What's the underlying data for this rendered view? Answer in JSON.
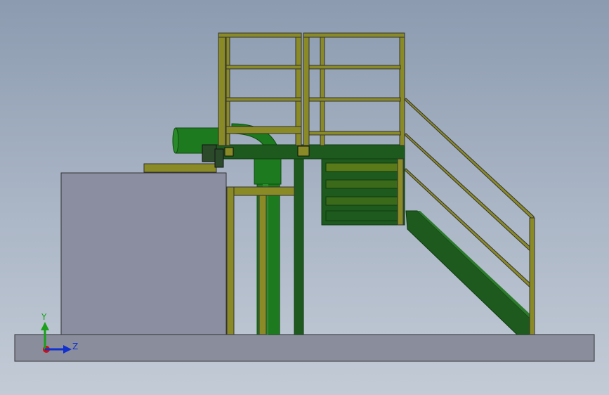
{
  "triad": {
    "y_label": "Y",
    "z_label": "Z",
    "colors": {
      "y": "#1aa01a",
      "z": "#1030d0",
      "x": "#d01010"
    }
  },
  "colors": {
    "rail_yellow": "#8a8a26",
    "rail_dark": "#4a4a10",
    "green_pipe": "#1e7a1e",
    "green_dark": "#0f4a0f",
    "tank_gray": "#8a8ea0",
    "floor_gray": "#8a8d9c"
  }
}
